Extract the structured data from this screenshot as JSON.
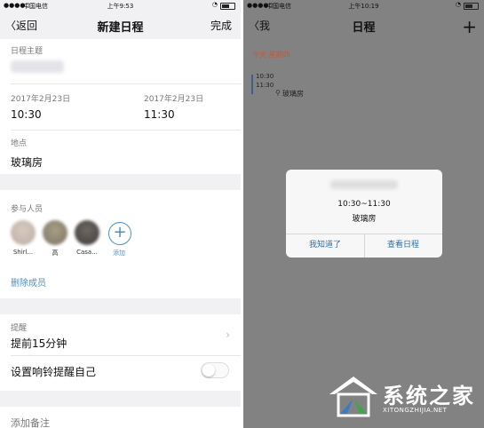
{
  "left": {
    "status": {
      "carrier": "中国电信",
      "time": "上午9:53"
    },
    "nav": {
      "back": "返回",
      "title": "新建日程",
      "done": "完成"
    },
    "subject_label": "日程主题",
    "start": {
      "date": "2017年2月23日",
      "time": "10:30"
    },
    "end": {
      "date": "2017年2月23日",
      "time": "11:30"
    },
    "location_label": "地点",
    "location_value": "玻璃房",
    "participants_label": "参与人员",
    "participants": [
      {
        "name": "Shirl..."
      },
      {
        "name": "高"
      },
      {
        "name": "Casa..."
      }
    ],
    "add_label": "添加",
    "remove_members": "删除成员",
    "reminder_label": "提醒",
    "reminder_value": "提前15分钟",
    "ring_label": "设置响铃提醒自己",
    "add_note": "添加备注"
  },
  "right": {
    "status": {
      "carrier": "中国电信",
      "time": "上午10:19"
    },
    "nav": {
      "back": "我",
      "title": "日程"
    },
    "today_label": "今天 星期四",
    "event": {
      "start": "10:30",
      "end": "11:30",
      "location": "玻璃房"
    },
    "dialog": {
      "time_range": "10:30~11:30",
      "location": "玻璃房",
      "btn_ok": "我知道了",
      "btn_view": "查看日程"
    }
  },
  "watermark": {
    "brand": "系统之家",
    "url": "XITONGZHIJIA.NET"
  }
}
